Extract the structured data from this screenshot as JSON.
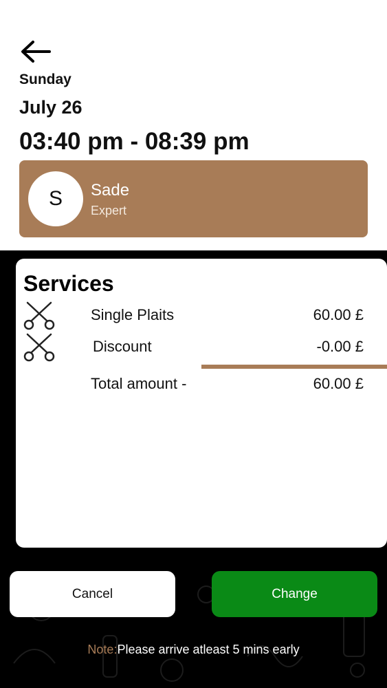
{
  "header": {
    "day": "Sunday",
    "date": "July 26",
    "time_range": "03:40 pm - 08:39 pm"
  },
  "expert": {
    "initial": "S",
    "name": "Sade",
    "role": "Expert"
  },
  "services": {
    "title": "Services",
    "items": [
      {
        "name": "Single Plaits",
        "price": "60.00 £",
        "icon": "scissors-icon"
      },
      {
        "name": "Discount",
        "price": "-0.00 £",
        "icon": "scissors-icon"
      }
    ],
    "total_label": "Total amount -",
    "total_value": "60.00 £"
  },
  "buttons": {
    "cancel_label": "Cancel",
    "change_label": "Change"
  },
  "note": {
    "label": "Note:",
    "text": "Please arrive atleast 5 mins early"
  },
  "colors": {
    "accent": "#a87c57",
    "change": "#0a8a16",
    "background": "#000000"
  }
}
